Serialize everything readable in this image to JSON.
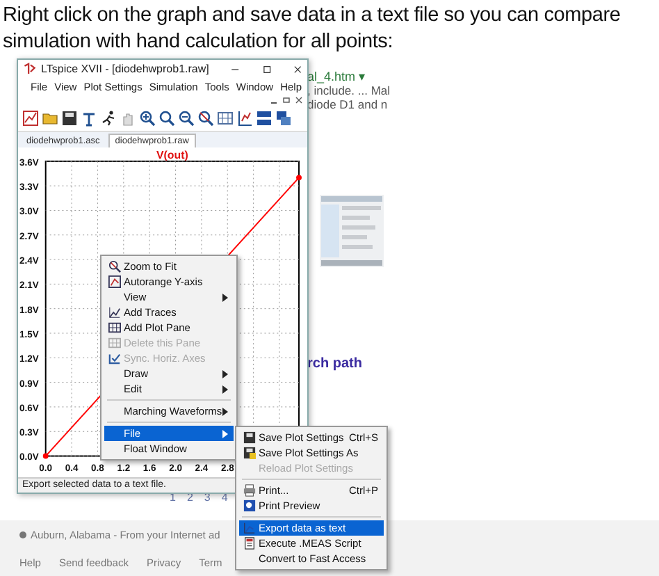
{
  "caption": "Right click on the graph and save data in a text file so you can compare simulation with hand calculation for all points:",
  "background_page": {
    "result_link": "al_4.htm ▾",
    "snippet_lines": [
      ", include. ... Mal",
      "diode D1 and n"
    ],
    "heading": "rch path",
    "pagination": [
      "1",
      "2",
      "3",
      "4"
    ],
    "location": "Auburn, Alabama - From your Internet ad",
    "footer_links": [
      "Help",
      "Send feedback",
      "Privacy",
      "Term"
    ]
  },
  "window": {
    "title": "LTspice XVII - [diodehwprob1.raw]",
    "menu": [
      "File",
      "View",
      "Plot Settings",
      "Simulation",
      "Tools",
      "Window",
      "Help"
    ],
    "tabs": [
      {
        "label": "diodehwprob1.asc",
        "selected": false
      },
      {
        "label": "diodehwprob1.raw",
        "selected": true
      }
    ],
    "plot": {
      "chart_data": {
        "type": "line",
        "grid": true,
        "x": [
          0,
          3.9
        ],
        "xlim": [
          0,
          3.9
        ],
        "ylim": [
          0,
          3.6
        ],
        "series": [
          {
            "name": "V(out)",
            "color": "#ff0000",
            "marker": "o",
            "values": [
              0,
              3.4
            ]
          }
        ],
        "yticks": [
          {
            "value": 0,
            "label": "0.0V"
          },
          {
            "value": 0.3,
            "label": "0.3V"
          },
          {
            "value": 0.6,
            "label": "0.6V"
          },
          {
            "value": 0.9,
            "label": "0.9V"
          },
          {
            "value": 1.2,
            "label": "1.2V"
          },
          {
            "value": 1.5,
            "label": "1.5V"
          },
          {
            "value": 1.8,
            "label": "1.8V"
          },
          {
            "value": 2.1,
            "label": "2.1V"
          },
          {
            "value": 2.4,
            "label": "2.4V"
          },
          {
            "value": 2.7,
            "label": "2.7V"
          },
          {
            "value": 3.0,
            "label": "3.0V"
          },
          {
            "value": 3.3,
            "label": "3.3V"
          },
          {
            "value": 3.6,
            "label": "3.6V"
          }
        ],
        "xticks": [
          {
            "value": 0,
            "label": "0.0"
          },
          {
            "value": 0.4,
            "label": "0.4"
          },
          {
            "value": 0.8,
            "label": "0.8"
          },
          {
            "value": 1.2,
            "label": "1.2"
          },
          {
            "value": 1.6,
            "label": "1.6"
          },
          {
            "value": 2.0,
            "label": "2.0"
          },
          {
            "value": 2.4,
            "label": "2.4"
          },
          {
            "value": 2.8,
            "label": "2.8"
          }
        ]
      }
    },
    "status_bar": "Export selected data to a text file."
  },
  "context_menu": [
    {
      "kind": "item",
      "label": "Zoom to Fit",
      "disabled": false,
      "checked": false,
      "submenu": false,
      "selected": false
    },
    {
      "kind": "item",
      "label": "Autorange Y-axis",
      "disabled": false,
      "checked": false,
      "submenu": false,
      "selected": false
    },
    {
      "kind": "item",
      "label": "View",
      "disabled": false,
      "checked": false,
      "submenu": true,
      "selected": false
    },
    {
      "kind": "item",
      "label": "Add Traces",
      "disabled": false,
      "checked": false,
      "submenu": false,
      "selected": false
    },
    {
      "kind": "item",
      "label": "Add Plot Pane",
      "disabled": false,
      "checked": false,
      "submenu": false,
      "selected": false
    },
    {
      "kind": "item",
      "label": "Delete this Pane",
      "disabled": true,
      "checked": false,
      "submenu": false,
      "selected": false
    },
    {
      "kind": "item",
      "label": "Sync. Horiz. Axes",
      "disabled": true,
      "checked": true,
      "submenu": false,
      "selected": false
    },
    {
      "kind": "item",
      "label": "Draw",
      "disabled": false,
      "checked": false,
      "submenu": true,
      "selected": false
    },
    {
      "kind": "item",
      "label": "Edit",
      "disabled": false,
      "checked": false,
      "submenu": true,
      "selected": false
    },
    {
      "kind": "separator"
    },
    {
      "kind": "item",
      "label": "Marching Waveforms",
      "disabled": false,
      "checked": false,
      "submenu": true,
      "selected": false
    },
    {
      "kind": "separator"
    },
    {
      "kind": "item",
      "label": "File",
      "disabled": false,
      "checked": false,
      "submenu": true,
      "selected": true
    },
    {
      "kind": "item",
      "label": "Float Window",
      "disabled": false,
      "checked": false,
      "submenu": false,
      "selected": false
    }
  ],
  "file_submenu": [
    {
      "kind": "item",
      "label": "Save Plot Settings",
      "shortcut": "Ctrl+S",
      "disabled": false,
      "selected": false
    },
    {
      "kind": "item",
      "label": "Save Plot Settings As",
      "disabled": false,
      "selected": false
    },
    {
      "kind": "item",
      "label": "Reload Plot Settings",
      "disabled": true,
      "selected": false
    },
    {
      "kind": "separator"
    },
    {
      "kind": "item",
      "label": "Print...",
      "shortcut": "Ctrl+P",
      "disabled": false,
      "selected": false
    },
    {
      "kind": "item",
      "label": "Print Preview",
      "disabled": false,
      "selected": false
    },
    {
      "kind": "separator"
    },
    {
      "kind": "item",
      "label": "Export data as text",
      "disabled": false,
      "selected": true
    },
    {
      "kind": "item",
      "label": "Execute .MEAS Script",
      "disabled": false,
      "selected": false
    },
    {
      "kind": "item",
      "label": "Convert to Fast Access",
      "disabled": false,
      "selected": false
    }
  ]
}
